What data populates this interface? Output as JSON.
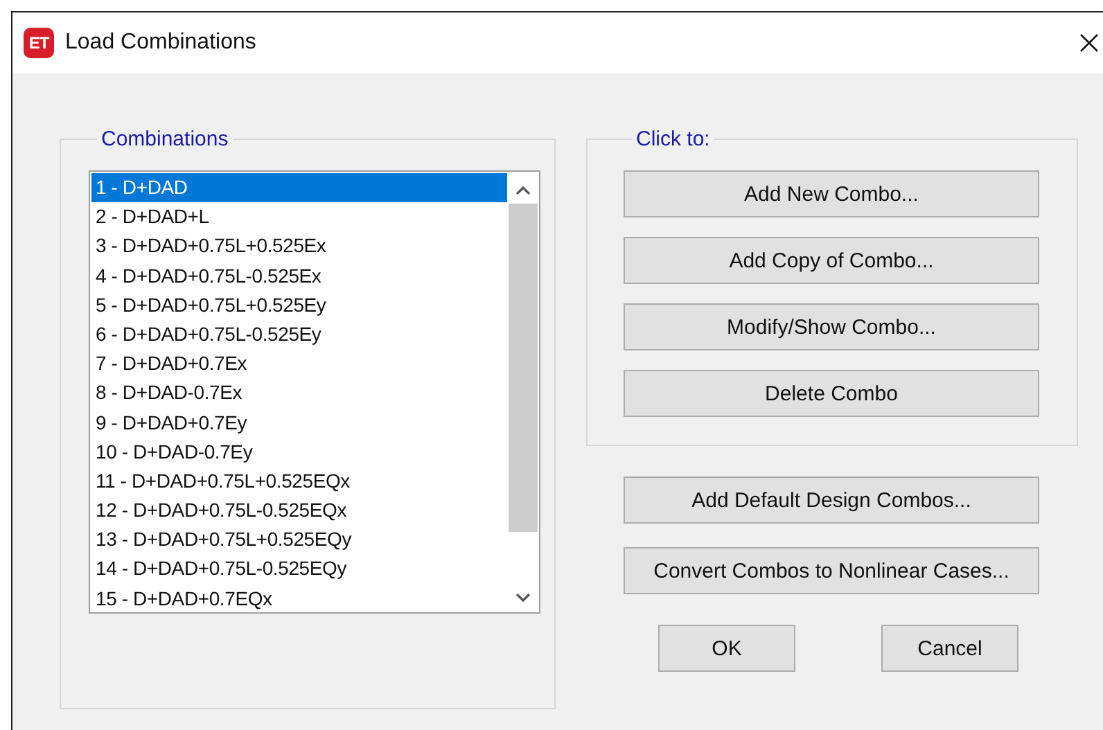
{
  "window": {
    "app_icon": "ET",
    "title": "Load Combinations"
  },
  "combinations": {
    "legend": "Combinations",
    "items": [
      {
        "label": "1 - D+DAD",
        "selected": true
      },
      {
        "label": "2 - D+DAD+L",
        "selected": false
      },
      {
        "label": "3 - D+DAD+0.75L+0.525Ex",
        "selected": false
      },
      {
        "label": "4 - D+DAD+0.75L-0.525Ex",
        "selected": false
      },
      {
        "label": "5 - D+DAD+0.75L+0.525Ey",
        "selected": false
      },
      {
        "label": "6 - D+DAD+0.75L-0.525Ey",
        "selected": false
      },
      {
        "label": "7 - D+DAD+0.7Ex",
        "selected": false
      },
      {
        "label": "8 - D+DAD-0.7Ex",
        "selected": false
      },
      {
        "label": "9 - D+DAD+0.7Ey",
        "selected": false
      },
      {
        "label": "10 - D+DAD-0.7Ey",
        "selected": false
      },
      {
        "label": "11 - D+DAD+0.75L+0.525EQx",
        "selected": false
      },
      {
        "label": "12 - D+DAD+0.75L-0.525EQx",
        "selected": false
      },
      {
        "label": "13 - D+DAD+0.75L+0.525EQy",
        "selected": false
      },
      {
        "label": "14 - D+DAD+0.75L-0.525EQy",
        "selected": false
      },
      {
        "label": "15 - D+DAD+0.7EQx",
        "selected": false
      }
    ]
  },
  "click_to": {
    "legend": "Click to:",
    "buttons": [
      "Add New Combo...",
      "Add Copy of Combo...",
      "Modify/Show Combo...",
      "Delete Combo"
    ]
  },
  "extra_buttons": [
    "Add Default Design Combos...",
    "Convert Combos to Nonlinear Cases..."
  ],
  "dialog_buttons": [
    "OK",
    "Cancel"
  ]
}
